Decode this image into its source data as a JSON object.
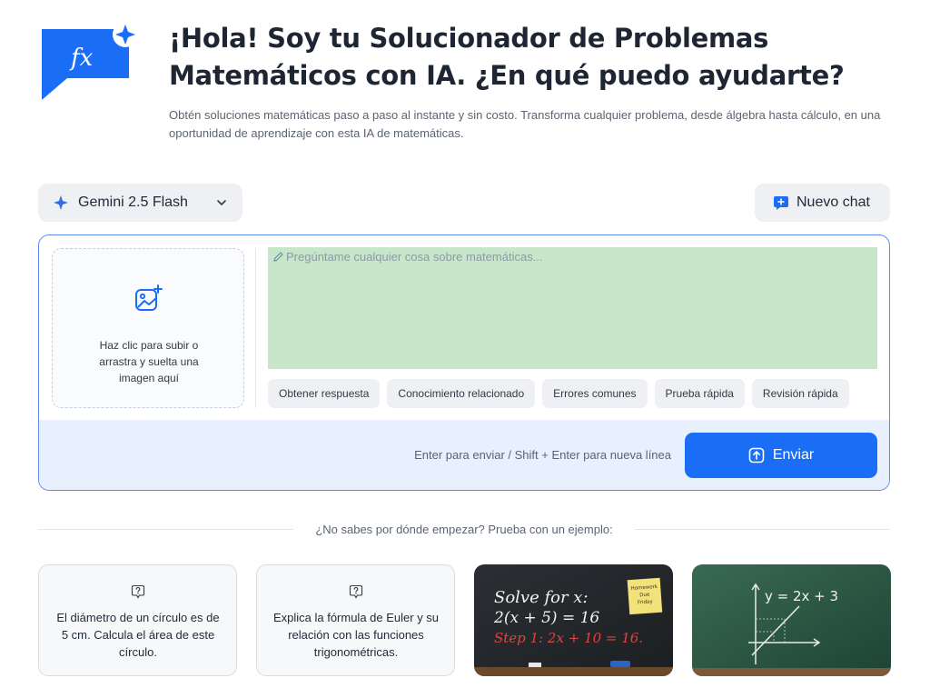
{
  "header": {
    "logo_text": "fx",
    "title": "¡Hola! Soy tu Solucionador de Problemas Matemáticos con IA. ¿En qué puedo ayudarte?",
    "subtitle": "Obtén soluciones matemáticas paso a paso al instante y sin costo. Transforma cualquier problema, desde álgebra hasta cálculo, en una oportunidad de aprendizaje con esta IA de matemáticas."
  },
  "toolbar": {
    "model_label": "Gemini 2.5 Flash",
    "new_chat_label": "Nuevo chat"
  },
  "composer": {
    "upload_text": "Haz clic para subir o arrastra y suelta una imagen aquí",
    "placeholder": "Pregúntame cualquier cosa sobre matemáticas...",
    "chips": [
      "Obtener respuesta",
      "Conocimiento relacionado",
      "Errores comunes",
      "Prueba rápida",
      "Revisión rápida"
    ],
    "hint": "Enter para enviar / Shift + Enter para nueva línea",
    "send_label": "Enviar"
  },
  "examples": {
    "divider_text": "¿No sabes por dónde empezar? Prueba con un ejemplo:",
    "cards": [
      {
        "text": "El diámetro de un círculo es de 5 cm. Calcula el área de este círculo."
      },
      {
        "text": "Explica la fórmula de Euler y su relación con las funciones trigonométricas."
      },
      {
        "line1": "Solve for x:",
        "line2": "2(x + 5) = 16",
        "line3": "Step 1: 2x + 10 = 16.",
        "note": "Homework Due Friday"
      },
      {
        "equation": "y = 2x + 3"
      }
    ]
  },
  "colors": {
    "accent": "#1a6ef5",
    "textarea_bg": "#c8e6c9",
    "footer_bg": "#e8effd"
  }
}
